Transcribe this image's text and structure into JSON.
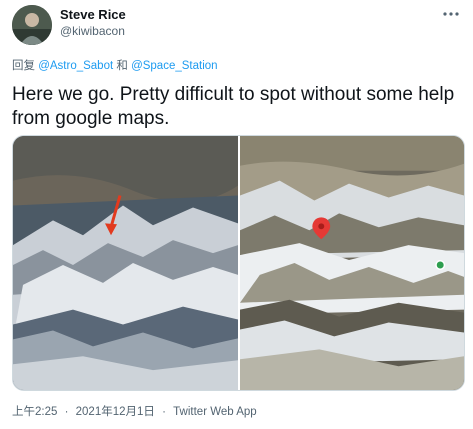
{
  "author": {
    "name": "Steve Rice",
    "handle": "@kiwibacon"
  },
  "reply": {
    "prefix": "回复 ",
    "mention1": "@Astro_Sabot",
    "joiner": " 和 ",
    "mention2": "@Space_Station"
  },
  "tweet": {
    "text": "Here we go. Pretty difficult to spot without some help from google maps."
  },
  "meta": {
    "time": "上午2:25",
    "dot": "·",
    "date": "2021年12月1日",
    "source": "Twitter Web App"
  },
  "colors": {
    "link": "#1d9bf0",
    "secondary": "#536471",
    "text": "#0f1419"
  },
  "icons": {
    "more": "more-horizontal-icon"
  }
}
